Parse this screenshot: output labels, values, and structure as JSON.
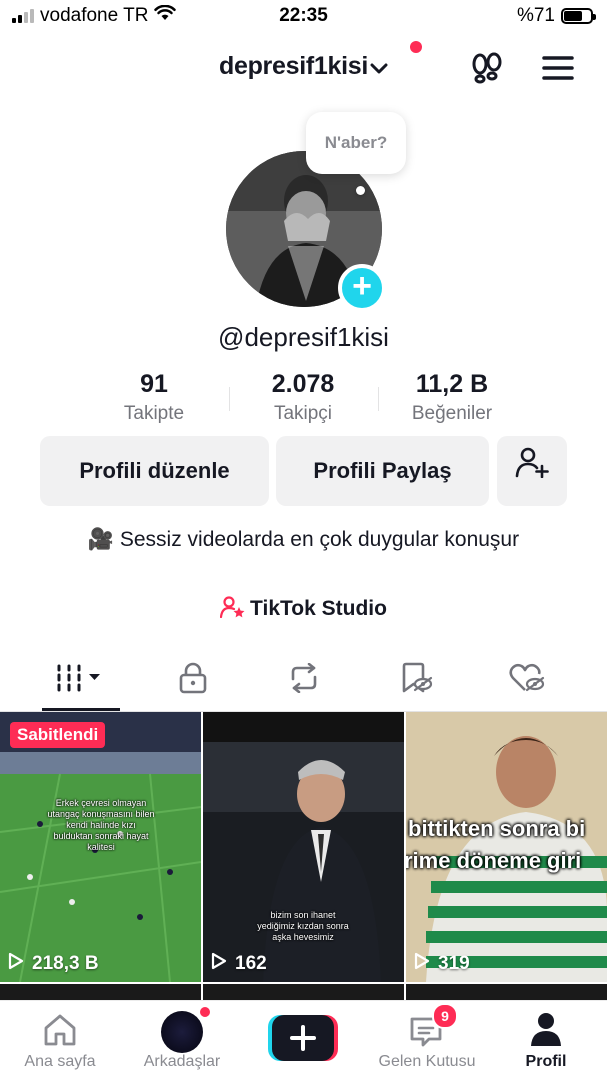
{
  "status_bar": {
    "carrier": "vodafone TR",
    "time": "22:35",
    "battery": "%71",
    "battery_level": 0.71
  },
  "header": {
    "username": "depresif1kisi"
  },
  "profile": {
    "note_bubble": "N'aber?",
    "handle": "@depresif1kisi",
    "stats": [
      {
        "value": "91",
        "label": "Takipte"
      },
      {
        "value": "2.078",
        "label": "Takipçi"
      },
      {
        "value": "11,2 B",
        "label": "Beğeniler"
      }
    ],
    "buttons": {
      "edit": "Profili düzenle",
      "share": "Profili Paylaş"
    },
    "bio_emoji": "🎥",
    "bio": "Sessiz videolarda en çok duygular konuşur",
    "studio_link": "TikTok Studio"
  },
  "videos": [
    {
      "pinned_label": "Sabitlendi",
      "caption": "Erkek çevresi olmayan utangaç konuşmasını bilen kendi halinde kızı bulduktan sonraki hayat kalitesi",
      "views": "218,3 B"
    },
    {
      "caption": "bizim son ihanet yediğimiz kızdan sonra aşka hevesimiz",
      "views": "162"
    },
    {
      "caption_line1": "bittikten sonra bi",
      "caption_line2": "rime döneme giri",
      "views": "319"
    }
  ],
  "bottom_nav": {
    "home": "Ana sayfa",
    "friends": "Arkadaşlar",
    "inbox": "Gelen Kutusu",
    "inbox_badge": "9",
    "profile": "Profil"
  },
  "colors": {
    "accent_red": "#fe2c55",
    "accent_cyan": "#20d5ec",
    "text": "#161823",
    "secondary_text": "#73747b",
    "button_bg": "#f1f1f2"
  }
}
